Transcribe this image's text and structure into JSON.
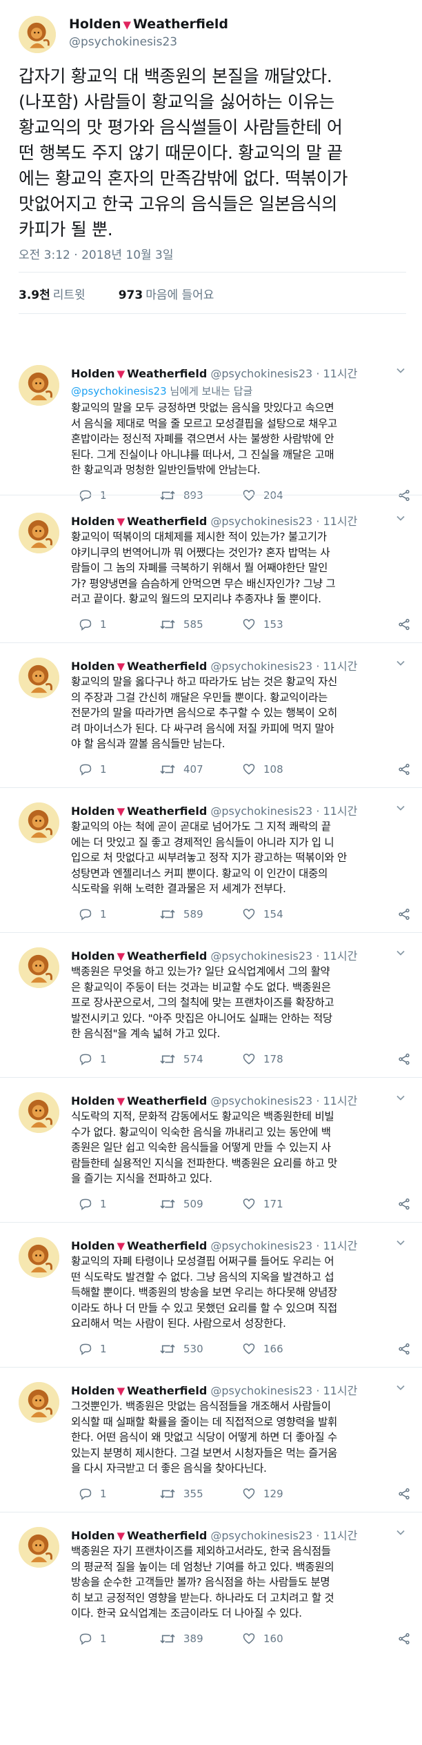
{
  "tweet": {
    "display_name": "Holden",
    "display_name_suffix": "Weatherfield",
    "handle": "@psychokinesis23",
    "text": "갑자기 황교익 대 백종원의 본질을 깨달았다.\n(나포함) 사람들이 황교익을 싫어하는 이유는\n황교익의 맛 평가와 음식썰들이 사람들한테 어\n떤 행복도 주지 않기 때문이다. 황교익의 말 끝\n에는 황교익 혼자의 만족감밖에 없다. 떡볶이가\n맛없어지고 한국 고유의 음식들은 일본음식의\n카피가 될 뿐.",
    "timestamp": "오전 3:12 · 2018년 10월 3일",
    "retweets_count": "3.9천",
    "retweets_label": "리트윗",
    "likes_count": "973",
    "likes_label": "마음에 들어요"
  },
  "colors": {
    "accent": "#1da1f2",
    "heart": "#e0245e",
    "text": "#14171a",
    "muted": "#657786",
    "divider": "#e6ecf0"
  },
  "icons": [
    "avatar-lion",
    "heart-icon",
    "reply-icon",
    "retweet-icon",
    "like-icon",
    "share-icon",
    "chevron-down-icon"
  ],
  "reply_to": {
    "mention": "@psychokinesis23",
    "suffix": " 님에게 보내는 답글"
  },
  "replies": [
    {
      "name": "Holden",
      "name_suffix": "Weatherfield",
      "handle": "@psychokinesis23",
      "time": "· 11시간",
      "text": "황교익의 말을 모두 긍정하면 맛없는 음식을 맛있다고 속으면\n서 음식을 제대로 먹을 줄 모르고 모성결핍을 설탕으로 채우고\n혼밥이라는 정신적 자폐를 겪으면서 사는 불쌍한 사람밖에 안\n된다. 그게 진실이나 아니냐를 떠나서, 그 진실을 깨달은 고매\n한 황교익과 멍청한 일반인들밖에 안남는다.",
      "replies": "1",
      "retweets": "893",
      "likes": "204"
    },
    {
      "name": "Holden",
      "name_suffix": "Weatherfield",
      "handle": "@psychokinesis23",
      "time": "· 11시간",
      "text": "황교익이 떡볶이의 대체제를 제시한 적이 있는가? 불고기가\n야키니쿠의 번역어니까 뭐 어쨌다는 것인가? 혼자 밥먹는 사\n람들이 그 놈의 자폐를 극복하기 위해서 뭘 어째야한단 말인\n가? 평양냉면을 슴슴하게 안먹으면 무슨 배신자인가? 그냥 그\n러고 끝이다. 황교익 월드의 모지리냐 추종자냐 둘 뿐이다.",
      "replies": "1",
      "retweets": "585",
      "likes": "153"
    },
    {
      "name": "Holden",
      "name_suffix": "Weatherfield",
      "handle": "@psychokinesis23",
      "time": "· 11시간",
      "text": "황교익의 말을 옳다구나 하고 따라가도 남는 것은 황교익 자신\n의 주장과 그걸 간신히 깨달은 우민들 뿐이다. 황교익이라는\n전문가의 말을 따라가면 음식으로 추구할 수 있는 행복이 오히\n려 마이너스가 된다. 다 싸구려 음식에 저질 카피에 먹지 말아\n야 할 음식과 깔볼 음식들만 남는다.",
      "replies": "1",
      "retweets": "407",
      "likes": "108"
    },
    {
      "name": "Holden",
      "name_suffix": "Weatherfield",
      "handle": "@psychokinesis23",
      "time": "· 11시간",
      "text": "황교익의 아는 척에 곧이 곧대로 넘어가도 그 지적 쾌락의 끝\n에는 더 맛있고 질 좋고 경제적인 음식들이 아니라 지가 입 니\n입으로 처 맛없다고 씨부려놓고 정작 지가 광고하는 떡볶이와 안\n성탕면과 엔젤리너스 커피 뿐이다. 황교익 이 인간이 대중의\n식도락을 위해 노력한 결과물은 저 세계가 전부다.",
      "replies": "1",
      "retweets": "589",
      "likes": "154"
    },
    {
      "name": "Holden",
      "name_suffix": "Weatherfield",
      "handle": "@psychokinesis23",
      "time": "· 11시간",
      "text": "백종원은 무엇을 하고 있는가? 일단 요식업계에서 그의 활약\n은 황교익이 주둥이 터는 것과는 비교할 수도 없다. 백종원은\n프로 장사꾼으로서, 그의 철칙에 맞는 프랜차이즈를 확장하고\n발전시키고 있다. \"아주 맛집은 아니어도 실패는 안하는 적당\n한 음식점\"을 계속 넓혀 가고 있다.",
      "replies": "1",
      "retweets": "574",
      "likes": "178"
    },
    {
      "name": "Holden",
      "name_suffix": "Weatherfield",
      "handle": "@psychokinesis23",
      "time": "· 11시간",
      "text": "식도락의 지적, 문화적 감동에서도 황교익은 백종원한테 비빌\n수가 없다. 황교익이 익숙한 음식을 까내리고 있는 동안에 백\n종원은 일단 쉽고 익숙한 음식들을 어떻게 만들 수 있는지 사\n람들한테 실용적인 지식을 전파한다. 백종원은 요리를 하고 맛\n을 즐기는 지식을 전파하고 있다.",
      "replies": "1",
      "retweets": "509",
      "likes": "171"
    },
    {
      "name": "Holden",
      "name_suffix": "Weatherfield",
      "handle": "@psychokinesis23",
      "time": "· 11시간",
      "text": "황교익의 자폐 타령이나 모성결핍 어쩌구를 들어도 우리는 어\n떤 식도락도 발견할 수 없다. 그냥 음식의 지옥을 발견하고 섭\n득해할 뿐이다. 백종원의 방송을 보면 우리는 하다못해 양념장\n이라도 하나 더 만들 수 있고 못했던 요리를 할 수 있으며 직접\n요리해서 먹는 사람이 된다. 사람으로서 성장한다.",
      "replies": "1",
      "retweets": "530",
      "likes": "166"
    },
    {
      "name": "Holden",
      "name_suffix": "Weatherfield",
      "handle": "@psychokinesis23",
      "time": "· 11시간",
      "text": "그것뿐인가. 백종원은 맛없는 음식점들을 개조해서 사람들이\n외식할 때 실패할 확률을 줄이는 데 직접적으로 영향력을 발휘\n한다. 어떤 음식이 왜 맛없고 식당이 어떻게 하면 더 좋아질 수\n있는지 분명히 제시한다. 그걸 보면서 시청자들은 먹는 즐거움\n을 다시 자극받고 더 좋은 음식을 찾아다닌다.",
      "replies": "1",
      "retweets": "355",
      "likes": "129"
    },
    {
      "name": "Holden",
      "name_suffix": "Weatherfield",
      "handle": "@psychokinesis23",
      "time": "· 11시간",
      "text": "백종원은 자기 프랜차이즈를 제외하고서라도, 한국 음식점들\n의 평균적 질을 높이는 데 엄청난 기여를 하고 있다. 백종원의\n방송을 순수한 고객들만 볼까? 음식점을 하는 사람들도 분명\n히 보고 긍정적인 영향을 받는다. 하나라도 더 고치려고 할 것\n이다. 한국 요식업계는 조금이라도 더 나아질 수 있다.",
      "replies": "1",
      "retweets": "389",
      "likes": "160"
    }
  ]
}
